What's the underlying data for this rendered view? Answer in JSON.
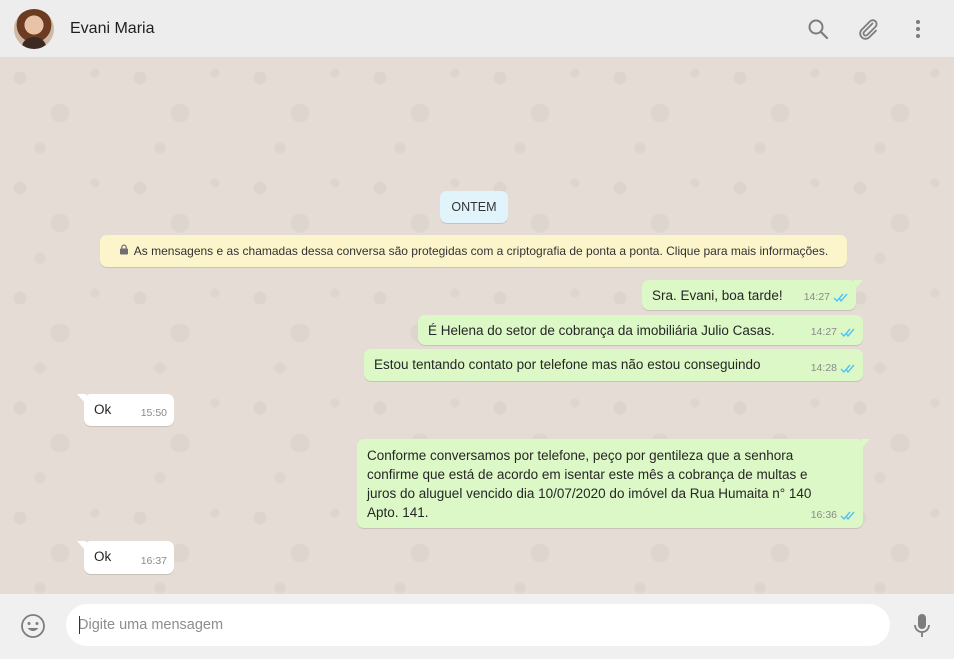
{
  "header": {
    "contact_name": "Evani Maria",
    "icons": [
      "search-icon",
      "attach-icon",
      "menu-icon"
    ]
  },
  "chat": {
    "date_chip": "ONTEM",
    "encryption_notice": "As mensagens e as chamadas dessa conversa são protegidas com a criptografia de ponta a ponta. Clique para mais informações.",
    "messages": [
      {
        "direction": "out",
        "text": "Sra. Evani, boa tarde!",
        "time": "14:27",
        "status": "read"
      },
      {
        "direction": "out",
        "text": "É Helena do setor de cobrança da imobiliária Julio Casas.",
        "time": "14:27",
        "status": "read"
      },
      {
        "direction": "out",
        "text": "Estou tentando contato por telefone mas não estou conseguindo",
        "time": "14:28",
        "status": "read"
      },
      {
        "direction": "in",
        "text": "Ok",
        "time": "15:50"
      },
      {
        "direction": "out",
        "lines": [
          "Conforme conversamos por telefone, peço por gentileza que a senhora",
          "confirme que está de acordo em isentar este mês a cobrança de multas e",
          "juros do aluguel vencido dia 10/07/2020 do imóvel da Rua Humaita n° 140",
          "Apto. 141."
        ],
        "time": "16:36",
        "status": "read"
      },
      {
        "direction": "in",
        "text": "Ok",
        "time": "16:37"
      }
    ]
  },
  "compose": {
    "placeholder": "Digite uma mensagem",
    "value": ""
  },
  "colors": {
    "outgoing_bubble": "#dcf8c6",
    "incoming_bubble": "#ffffff",
    "read_ticks": "#4fc3f7",
    "chat_background": "#e5ddd5"
  }
}
